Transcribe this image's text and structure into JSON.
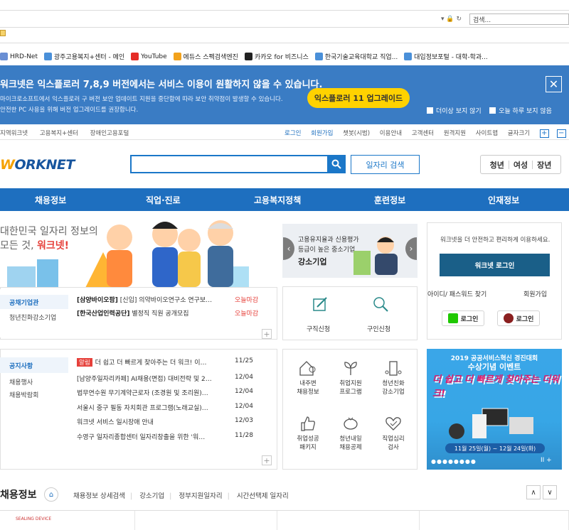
{
  "browser": {
    "search_placeholder": "검색...",
    "favorites": [
      {
        "label": "HRD-Net",
        "color": "#6a8fd4"
      },
      {
        "label": "광주고용복지+센터 - 메인",
        "color": "#4a90d9"
      },
      {
        "label": "YouTube",
        "color": "#e52d27"
      },
      {
        "label": "에듀스 스펙검색엔진",
        "color": "#f2a21c"
      },
      {
        "label": "카카오 for 비즈니스",
        "color": "#222222"
      },
      {
        "label": "한국기술교육대학교 직업...",
        "color": "#4a90d9"
      },
      {
        "label": "대입정보포털 - 대학-학과...",
        "color": "#4a90d9"
      }
    ]
  },
  "banner": {
    "headline": "워크넷은 익스플로러 7,8,9 버전에서는 서비스 이용이 원활하지 않을 수 있습니다.",
    "line1": "마이크로소프트에서 익스플로러 구 버전 보안 업데이트 지원을 중단함에 따라 보안 취약점이 발생할 수 있습니다.",
    "line2": "안전한 PC 사용을 위해 버전 업그레이드를 권장합니다.",
    "upgrade_label": "익스플로러 11 업그레이드",
    "opt1": "더이상 보지 않기",
    "opt2": "오늘 하루 보지 않음",
    "close": "✕"
  },
  "util": {
    "left": [
      "지역워크넷",
      "고용복지+센터",
      "장애인고용포털"
    ],
    "right": [
      "로그인",
      "회원가입",
      "챗봇(시범)",
      "이용안내",
      "고객센터",
      "원격지원",
      "사이트맵",
      "글자크기"
    ],
    "fontsize": [
      "+",
      "−",
      "O"
    ]
  },
  "header": {
    "logo_w": "W",
    "logo_rest": "ORKNET",
    "search_value": "",
    "job_search_label": "일자리 검색",
    "segments": [
      "청년",
      "여성",
      "장년"
    ]
  },
  "gnb": [
    "채용정보",
    "직업·진로",
    "고용복지정책",
    "훈련정보",
    "인재정보"
  ],
  "hero": {
    "line1": "대한민국 일자리 정보의",
    "line2_pre": "모든 것,",
    "line2_brand": "워크넷!"
  },
  "gong": {
    "tabs": [
      "공채기업관",
      "청년친화강소기업"
    ],
    "rows": [
      {
        "title": "[삼양바이오팜]",
        "desc": "[신입] 의약바이오연구소 연구보…",
        "status": "오늘마감"
      },
      {
        "title": "[한국산업인력공단]",
        "desc": "별정직 직원 공개모집",
        "status": "오늘마감"
      }
    ]
  },
  "notice": {
    "tabs": [
      "공지사항",
      "채용행사",
      "채용박람회"
    ],
    "rows": [
      {
        "tag": "알림",
        "text": "더 쉽고 더 빠르게 찾아주는 더 워크! 이…",
        "date": "11/25"
      },
      {
        "tag": "",
        "text": "[남양주일자리카페] AI채용(면접) 대비전략 및 2…",
        "date": "12/04"
      },
      {
        "tag": "",
        "text": "법무연수원 무기계약근로자 (조경원 및 조리원)…",
        "date": "12/04"
      },
      {
        "tag": "",
        "text": "서울시 중구 필동 자치회관 프로그램(노래교실)…",
        "date": "12/04"
      },
      {
        "tag": "",
        "text": "워크넷 서비스 일시장애 안내",
        "date": "12/03"
      },
      {
        "tag": "",
        "text": "수영구 일자리종합센터 일자리창출을 위한 '워…",
        "date": "11/28"
      }
    ]
  },
  "card": {
    "l1": "고용유지율과 신용평가",
    "l2": "등급이 높은 중소기업",
    "l3": "강소기업"
  },
  "apply": [
    "구직신청",
    "구인신청"
  ],
  "services": [
    [
      "내주변",
      "채용정보"
    ],
    [
      "취업지원",
      "프로그램"
    ],
    [
      "청년친화",
      "강소기업"
    ],
    [
      "취업성공",
      "패키지"
    ],
    [
      "청년내일",
      "채용공제"
    ],
    [
      "직업심리",
      "검사"
    ]
  ],
  "login": {
    "msg": "워크넷을 더 안전하고 편리하게 이용하세요.",
    "btn": "워크넷 로그인",
    "find": "아이디/ 패스워드 찾기",
    "join": "회원가입",
    "naver": "로그인",
    "kakao": "로그인"
  },
  "event": {
    "line1": "2019 공공서비스혁신 경진대회",
    "line2": "수상기념 이벤트",
    "big": "더 쉽고 더 빠르게 찾아주는 더워크!",
    "date": "11월 25일(월) ~ 12월 24일(화)",
    "dots": "●●●●●●●●",
    "ctl": "II  +"
  },
  "section": {
    "title": "채용정보",
    "links": [
      "채용정보 상세검색",
      "강소기업",
      "정부지원일자리",
      "시간선택제 일자리"
    ]
  },
  "bottom": {
    "sealing": "SEALING DEVICE"
  },
  "colors": {
    "primary": "#1e6fbf",
    "banner": "#3a7cc4",
    "accent": "#e6413b",
    "upgrade": "#ffd200"
  }
}
